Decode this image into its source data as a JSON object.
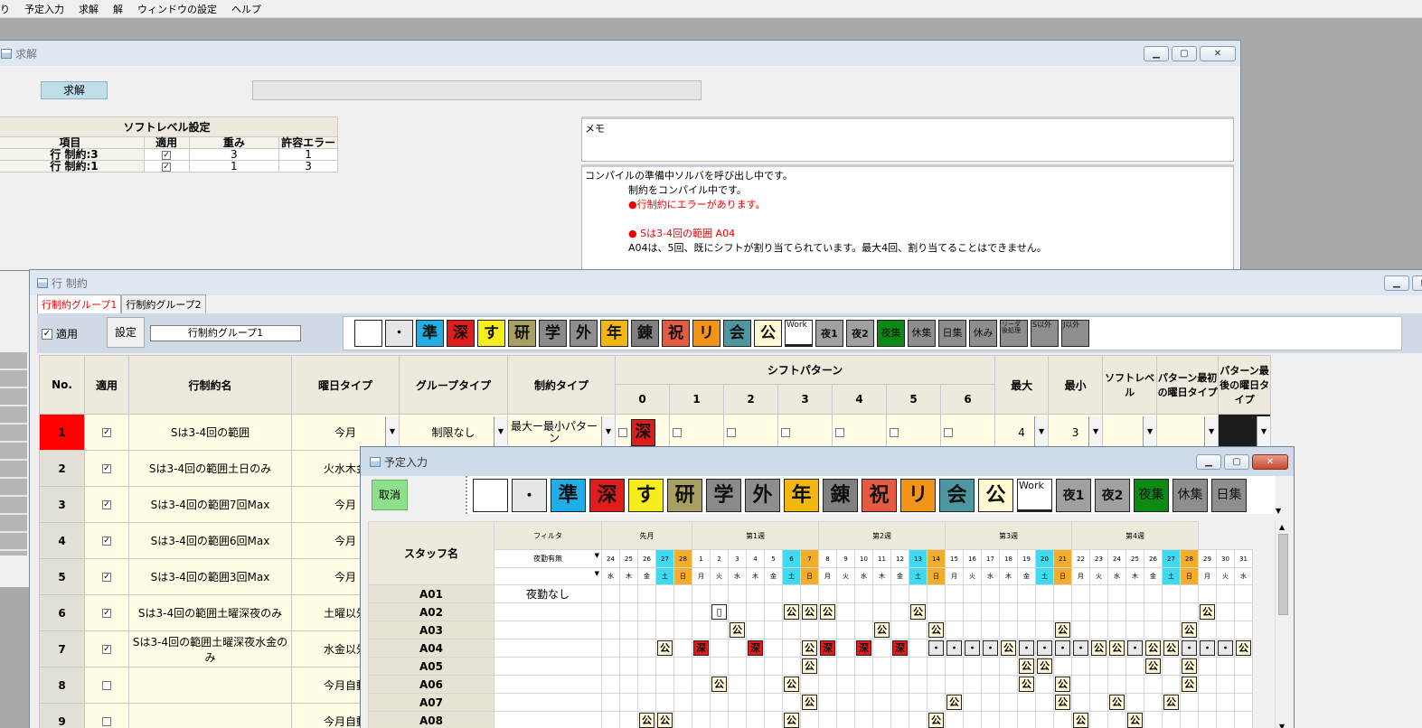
{
  "menu": [
    "り",
    "予定入力",
    "求解",
    "解",
    "ウィンドウの設定",
    "ヘルプ"
  ],
  "solve_window": {
    "title": "求解",
    "solve_button": "求解",
    "soft_level": {
      "title": "ソフトレベル設定",
      "headers": [
        "項目",
        "適用",
        "重み",
        "許容エラー"
      ],
      "rows": [
        {
          "item": "行 制約:3",
          "weight": "3",
          "tol": "1"
        },
        {
          "item": "行 制約:1",
          "weight": "1",
          "tol": "3"
        }
      ]
    },
    "memo_label": "メモ",
    "log": {
      "l1": "コンパイルの準備中ソルバを呼び出し中です。",
      "l2": "制約をコンパイル中です。",
      "l3": "●行制約にエラーがあります。",
      "l4": "● Sは3-4回の範囲 A04",
      "l5": "A04は、5回、既にシフトが割り当てられています。最大4回、割り当てることはできません。"
    }
  },
  "row_window": {
    "title": "行 制約",
    "tabs": [
      "行制約グループ1",
      "行制約グループ2"
    ],
    "apply_label": "適用",
    "settings_button": "設定",
    "group_name": "行制約グループ1",
    "palette": [
      {
        "t": "",
        "bg": "#ffffff",
        "fs": 14
      },
      {
        "t": "・",
        "bg": "#e6e6e6",
        "fs": 14
      },
      {
        "t": "準",
        "bg": "#1faee6",
        "fs": 17
      },
      {
        "t": "深",
        "bg": "#e21b1b",
        "fs": 17
      },
      {
        "t": "す",
        "bg": "#f4ec1c",
        "fs": 17
      },
      {
        "t": "研",
        "bg": "#a89f62",
        "fs": 17
      },
      {
        "t": "学",
        "bg": "#8a8a8a",
        "fs": 17
      },
      {
        "t": "外",
        "bg": "#8e8e8e",
        "fs": 17
      },
      {
        "t": "年",
        "bg": "#f2b710",
        "fs": 17
      },
      {
        "t": "錬",
        "bg": "#808080",
        "fs": 17
      },
      {
        "t": "祝",
        "bg": "#e55b42",
        "fs": 17
      },
      {
        "t": "リ",
        "bg": "#f29418",
        "fs": 17
      },
      {
        "t": "会",
        "bg": "#4c97a0",
        "fs": 17
      },
      {
        "t": "公",
        "bg": "#fff8d0",
        "fs": 17
      },
      {
        "t": "Work",
        "bg": "#ffffff",
        "fs": 9
      },
      {
        "t": "夜1",
        "bg": "#a0a0a0",
        "fs": 11
      },
      {
        "t": "夜2",
        "bg": "#a0a0a0",
        "fs": 11
      },
      {
        "t": "夜集",
        "bg": "#0c8a13",
        "fs": 11
      },
      {
        "t": "休集",
        "bg": "#8e8e8e",
        "fs": 11
      },
      {
        "t": "日集",
        "bg": "#8e8e8e",
        "fs": 11
      },
      {
        "t": "休み",
        "bg": "#8e8e8e",
        "fs": 11
      },
      {
        "t": "リーダ後処理",
        "bg": "#8e8e8e",
        "fs": 7
      },
      {
        "t": "S以外",
        "bg": "#8e8e8e",
        "fs": 8
      },
      {
        "t": "J以外",
        "bg": "#8e8e8e",
        "fs": 8
      }
    ],
    "headers": {
      "no": "No.",
      "apply": "適用",
      "name": "行制約名",
      "day": "曜日タイプ",
      "group": "グループタイプ",
      "ctype": "制約タイプ",
      "pattern": "シフトパターン",
      "cols": [
        "0",
        "1",
        "2",
        "3",
        "4",
        "5",
        "6"
      ],
      "max": "最大",
      "min": "最小",
      "soft": "ソフトレベル",
      "first": "パターン最初の曜日タイプ",
      "last": "パターン最後の曜日タイプ"
    },
    "row1": {
      "no": "1",
      "name": "Sは3-4回の範囲",
      "day": "今月",
      "group": "制限なし",
      "ctype": "最大ー最小パターン",
      "p0": "深",
      "max": "4",
      "min": "3"
    },
    "rows": [
      {
        "no": "2",
        "name": "Sは3-4回の範囲土日のみ",
        "day": "火水木金",
        "checked": "☑"
      },
      {
        "no": "3",
        "name": "Sは3-4回の範囲7回Max",
        "day": "今月",
        "checked": "☑"
      },
      {
        "no": "4",
        "name": "Sは3-4回の範囲6回Max",
        "day": "今月",
        "checked": "☑"
      },
      {
        "no": "5",
        "name": "Sは3-4回の範囲3回Max",
        "day": "今月",
        "checked": "☑"
      },
      {
        "no": "6",
        "name": "Sは3-4回の範囲土曜深夜のみ",
        "day": "土曜以外",
        "checked": "☑"
      },
      {
        "no": "7",
        "name": "Sは3-4回の範囲土曜深夜水金のみ",
        "day": "水金以外",
        "checked": "☑"
      },
      {
        "no": "8",
        "name": "",
        "day": "今月自動",
        "checked": "☐"
      },
      {
        "no": "9",
        "name": "",
        "day": "今月自動",
        "checked": "☐"
      }
    ]
  },
  "sched_window": {
    "title": "予定入力",
    "cancel": "取消",
    "palette": [
      {
        "t": "",
        "bg": "#ffffff",
        "fs": 16
      },
      {
        "t": "・",
        "bg": "#e6e6e6",
        "fs": 16
      },
      {
        "t": "準",
        "bg": "#1faee6",
        "fs": 22
      },
      {
        "t": "深",
        "bg": "#e21b1b",
        "fs": 22
      },
      {
        "t": "す",
        "bg": "#f4ec1c",
        "fs": 22
      },
      {
        "t": "研",
        "bg": "#a89f62",
        "fs": 22
      },
      {
        "t": "学",
        "bg": "#8a8a8a",
        "fs": 22
      },
      {
        "t": "外",
        "bg": "#8e8e8e",
        "fs": 22
      },
      {
        "t": "年",
        "bg": "#f2b710",
        "fs": 22
      },
      {
        "t": "錬",
        "bg": "#808080",
        "fs": 22
      },
      {
        "t": "祝",
        "bg": "#e55b42",
        "fs": 22
      },
      {
        "t": "リ",
        "bg": "#f29418",
        "fs": 22
      },
      {
        "t": "会",
        "bg": "#4c97a0",
        "fs": 22
      },
      {
        "t": "公",
        "bg": "#fff8d0",
        "fs": 22
      },
      {
        "t": "Work",
        "bg": "#ffffff",
        "fs": 11
      },
      {
        "t": "夜1",
        "bg": "#a0a0a0",
        "fs": 14
      },
      {
        "t": "夜2",
        "bg": "#a0a0a0",
        "fs": 14
      },
      {
        "t": "夜集",
        "bg": "#0c8a13",
        "fs": 14
      },
      {
        "t": "休集",
        "bg": "#8e8e8e",
        "fs": 14
      },
      {
        "t": "日集",
        "bg": "#8e8e8e",
        "fs": 14
      }
    ],
    "staff_header": "スタッフ名",
    "filter": "フィルタ",
    "night_filter": "夜勤有無",
    "weeks": [
      "先月",
      "第1週",
      "第2週",
      "第3週",
      "第4週"
    ],
    "dates": [
      "24",
      "25",
      "26",
      "27",
      "28",
      "1",
      "2",
      "3",
      "4",
      "5",
      "6",
      "7",
      "8",
      "9",
      "10",
      "11",
      "12",
      "13",
      "14",
      "15",
      "16",
      "17",
      "18",
      "19",
      "20",
      "21",
      "22",
      "23",
      "24",
      "25",
      "26",
      "27",
      "28",
      "29",
      "30",
      "31"
    ],
    "dows": [
      "水",
      "木",
      "金",
      "土",
      "日",
      "月",
      "火",
      "水",
      "木",
      "金",
      "土",
      "日",
      "月",
      "火",
      "水",
      "木",
      "金",
      "土",
      "日",
      "月",
      "火",
      "水",
      "木",
      "金",
      "土",
      "日",
      "月",
      "火",
      "水",
      "木",
      "金",
      "土",
      "日",
      "月",
      "火",
      "水"
    ],
    "staff": [
      {
        "name": "A01",
        "filter": "夜勤なし",
        "cells": {}
      },
      {
        "name": "A02",
        "filter": "",
        "cells": {
          "6": "▯",
          "10": "公",
          "11": "公",
          "12": "公",
          "17": "公",
          "33": "公"
        }
      },
      {
        "name": "A03",
        "filter": "",
        "cells": {
          "7": "公",
          "15": "公",
          "18": "公",
          "25": "公",
          "32": "公"
        }
      },
      {
        "name": "A04",
        "filter": "",
        "cells": {
          "3": "公",
          "5": "深",
          "8": "深",
          "11": "公",
          "12": "深",
          "14": "深",
          "16": "深",
          "18": "・",
          "19": "・",
          "20": "・",
          "21": "・",
          "22": "公",
          "23": "・",
          "24": "・",
          "25": "・",
          "26": "・",
          "27": "公",
          "28": "公",
          "29": "・",
          "30": "公",
          "31": "公",
          "32": "・",
          "33": "・",
          "34": "・",
          "35": "公"
        }
      },
      {
        "name": "A05",
        "filter": "",
        "cells": {
          "11": "公",
          "23": "公",
          "24": "公",
          "30": "公",
          "32": "公"
        }
      },
      {
        "name": "A06",
        "filter": "",
        "cells": {
          "6": "公",
          "10": "公",
          "23": "公",
          "25": "公",
          "32": "公"
        }
      },
      {
        "name": "A07",
        "filter": "",
        "cells": {
          "11": "公",
          "19": "公",
          "25": "公",
          "28": "公",
          "31": "公"
        }
      },
      {
        "name": "A08",
        "filter": "",
        "cells": {
          "2": "公",
          "3": "公",
          "10": "公",
          "18": "公",
          "26": "公",
          "29": "公"
        }
      }
    ]
  }
}
